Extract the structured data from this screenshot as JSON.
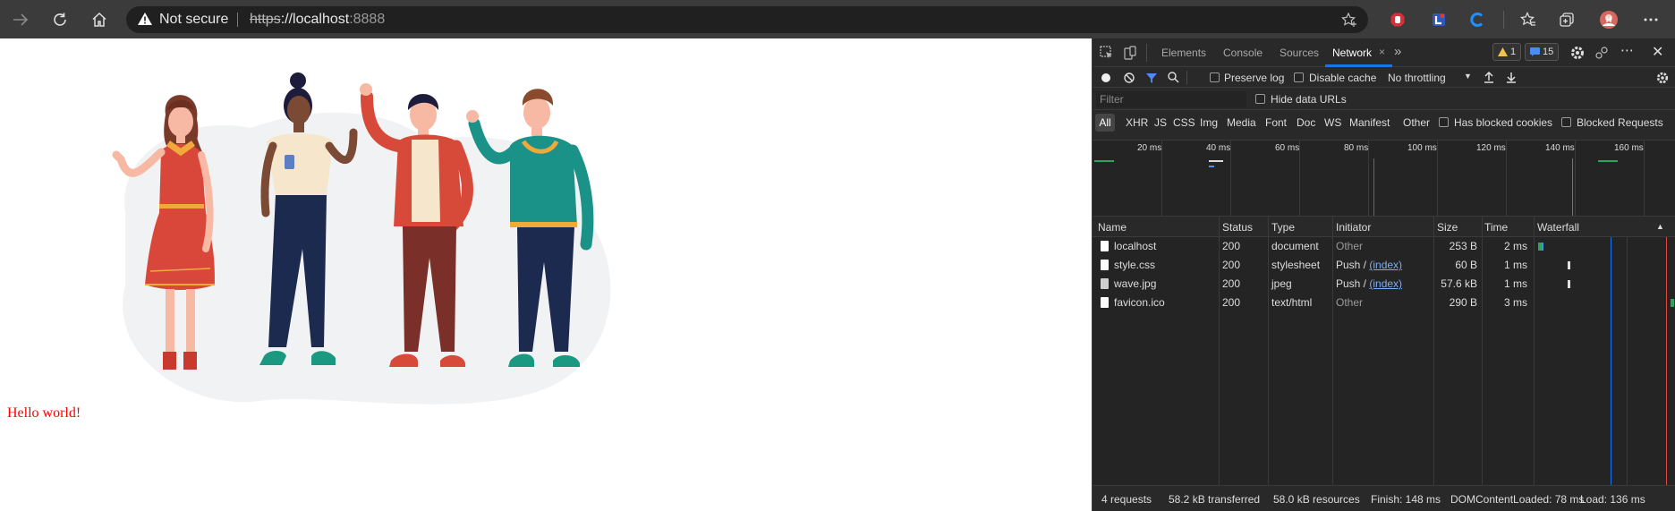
{
  "browser": {
    "security_text": "Not secure",
    "url_scheme": "https",
    "url_sep": "://",
    "url_host": "localhost",
    "url_port": ":8888"
  },
  "page": {
    "hello_text": "Hello world!",
    "hello_color": "#ff0000"
  },
  "devtools": {
    "tabs": [
      "Elements",
      "Console",
      "Sources",
      "Network"
    ],
    "active_tab": "Network",
    "warnings_count": "1",
    "messages_count": "15",
    "toolbar": {
      "preserve_log": "Preserve log",
      "disable_cache": "Disable cache",
      "throttling": "No throttling"
    },
    "filter": {
      "placeholder": "Filter",
      "hide_data_urls": "Hide data URLs",
      "types": [
        "All",
        "XHR",
        "JS",
        "CSS",
        "Img",
        "Media",
        "Font",
        "Doc",
        "WS",
        "Manifest",
        "Other"
      ],
      "has_blocked_cookies": "Has blocked cookies",
      "blocked_requests": "Blocked Requests"
    },
    "overview_ticks": [
      "20 ms",
      "40 ms",
      "60 ms",
      "80 ms",
      "100 ms",
      "120 ms",
      "140 ms",
      "160 ms"
    ],
    "columns": [
      "Name",
      "Status",
      "Type",
      "Initiator",
      "Size",
      "Time",
      "Waterfall"
    ],
    "requests": [
      {
        "name": "localhost",
        "status": "200",
        "type": "document",
        "initiator": "Other",
        "initiator_link": "",
        "size": "253 B",
        "time": "2 ms",
        "icon": "document-icon"
      },
      {
        "name": "style.css",
        "status": "200",
        "type": "stylesheet",
        "initiator": "Push / ",
        "initiator_link": "(index)",
        "size": "60 B",
        "time": "1 ms",
        "icon": "document-icon"
      },
      {
        "name": "wave.jpg",
        "status": "200",
        "type": "jpeg",
        "initiator": "Push / ",
        "initiator_link": "(index)",
        "size": "57.6 kB",
        "time": "1 ms",
        "icon": "image-icon"
      },
      {
        "name": "favicon.ico",
        "status": "200",
        "type": "text/html",
        "initiator": "Other",
        "initiator_link": "",
        "size": "290 B",
        "time": "3 ms",
        "icon": "document-icon"
      }
    ],
    "status": {
      "requests": "4 requests",
      "transferred": "58.2 kB transferred",
      "resources": "58.0 kB resources",
      "finish": "Finish: 148 ms",
      "dom_loaded": "DOMContentLoaded: 78 ms",
      "load": "Load: 136 ms"
    },
    "colors": {
      "dom_content_loaded_line": "#1a73e8",
      "load_line": "#e34a3a",
      "waterfall_green": "#2ea35e"
    }
  }
}
